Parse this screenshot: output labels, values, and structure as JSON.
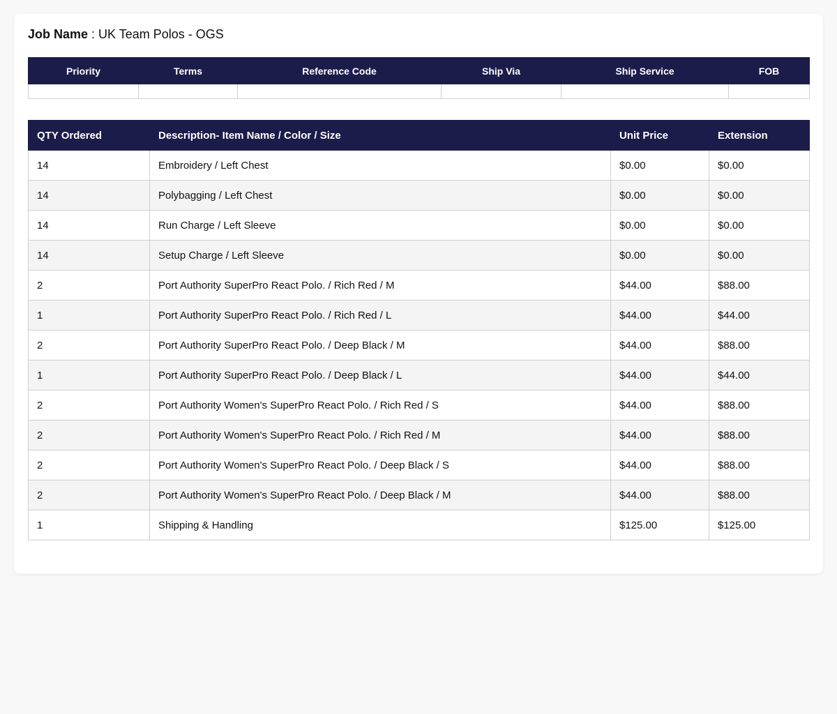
{
  "job": {
    "label": "Job Name",
    "separator": " : ",
    "value": "UK Team Polos - OGS"
  },
  "meta_table": {
    "headers": [
      "Priority",
      "Terms",
      "Reference Code",
      "Ship Via",
      "Ship Service",
      "FOB"
    ],
    "values": [
      "",
      "",
      "",
      "",
      "",
      ""
    ]
  },
  "items_table": {
    "headers": [
      "QTY Ordered",
      "Description- Item Name / Color / Size",
      "Unit Price",
      "Extension"
    ],
    "rows": [
      {
        "qty": "14",
        "desc": "Embroidery / Left Chest",
        "unit": "$0.00",
        "ext": "$0.00"
      },
      {
        "qty": "14",
        "desc": "Polybagging / Left Chest",
        "unit": "$0.00",
        "ext": "$0.00"
      },
      {
        "qty": "14",
        "desc": "Run Charge / Left Sleeve",
        "unit": "$0.00",
        "ext": "$0.00"
      },
      {
        "qty": "14",
        "desc": "Setup Charge / Left Sleeve",
        "unit": "$0.00",
        "ext": "$0.00"
      },
      {
        "qty": "2",
        "desc": "Port Authority SuperPro React Polo. / Rich Red / M",
        "unit": "$44.00",
        "ext": "$88.00"
      },
      {
        "qty": "1",
        "desc": "Port Authority SuperPro React Polo. / Rich Red / L",
        "unit": "$44.00",
        "ext": "$44.00"
      },
      {
        "qty": "2",
        "desc": "Port Authority SuperPro React Polo. / Deep Black / M",
        "unit": "$44.00",
        "ext": "$88.00"
      },
      {
        "qty": "1",
        "desc": "Port Authority SuperPro React Polo. / Deep Black / L",
        "unit": "$44.00",
        "ext": "$44.00"
      },
      {
        "qty": "2",
        "desc": "Port Authority Women's SuperPro React Polo. / Rich Red / S",
        "unit": "$44.00",
        "ext": "$88.00"
      },
      {
        "qty": "2",
        "desc": "Port Authority Women's SuperPro React Polo. / Rich Red / M",
        "unit": "$44.00",
        "ext": "$88.00"
      },
      {
        "qty": "2",
        "desc": "Port Authority Women's SuperPro React Polo. / Deep Black / S",
        "unit": "$44.00",
        "ext": "$88.00"
      },
      {
        "qty": "2",
        "desc": "Port Authority Women's SuperPro React Polo. / Deep Black / M",
        "unit": "$44.00",
        "ext": "$88.00"
      },
      {
        "qty": "1",
        "desc": "Shipping & Handling",
        "unit": "$125.00",
        "ext": "$125.00"
      }
    ]
  },
  "colors": {
    "header_bg": "#1c1c4b",
    "header_text": "#ffffff",
    "row_alt_bg": "#f4f4f4",
    "border": "#cfcfcf"
  }
}
